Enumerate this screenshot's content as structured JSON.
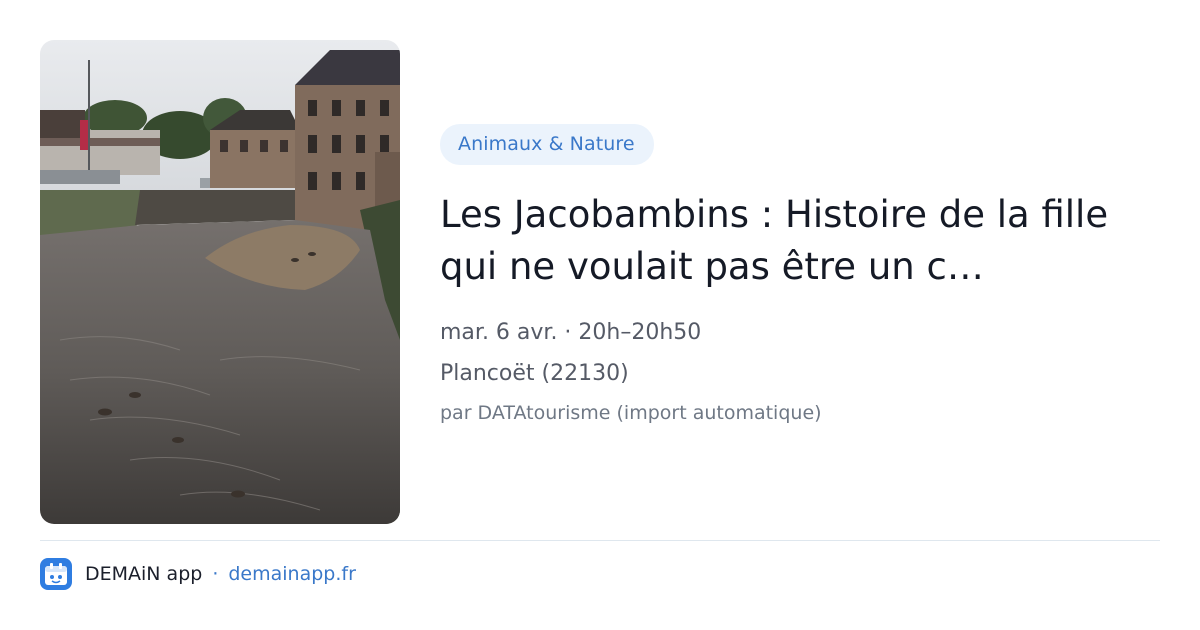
{
  "event": {
    "image_alt": "Rivière à marée basse avec des canards, bâtiments en pierre",
    "category": "Animaux & Nature",
    "title": "Les Jacobambins : Histoire de la fille qui ne voulait pas être un c…",
    "when": "mar. 6 avr. · 20h–20h50",
    "where": "Plancoët (22130)",
    "source": "par DATAtourisme (import automatique)"
  },
  "footer": {
    "app_name": "DEMAiN app",
    "separator": "·",
    "url": "demainapp.fr"
  },
  "colors": {
    "accent": "#3a78c9",
    "category_bg": "#ebf3fc",
    "title": "#151a26",
    "meta": "#555a66",
    "app_icon": "#2f7de1"
  },
  "icons": {
    "app_icon": "calendar-face-icon"
  }
}
